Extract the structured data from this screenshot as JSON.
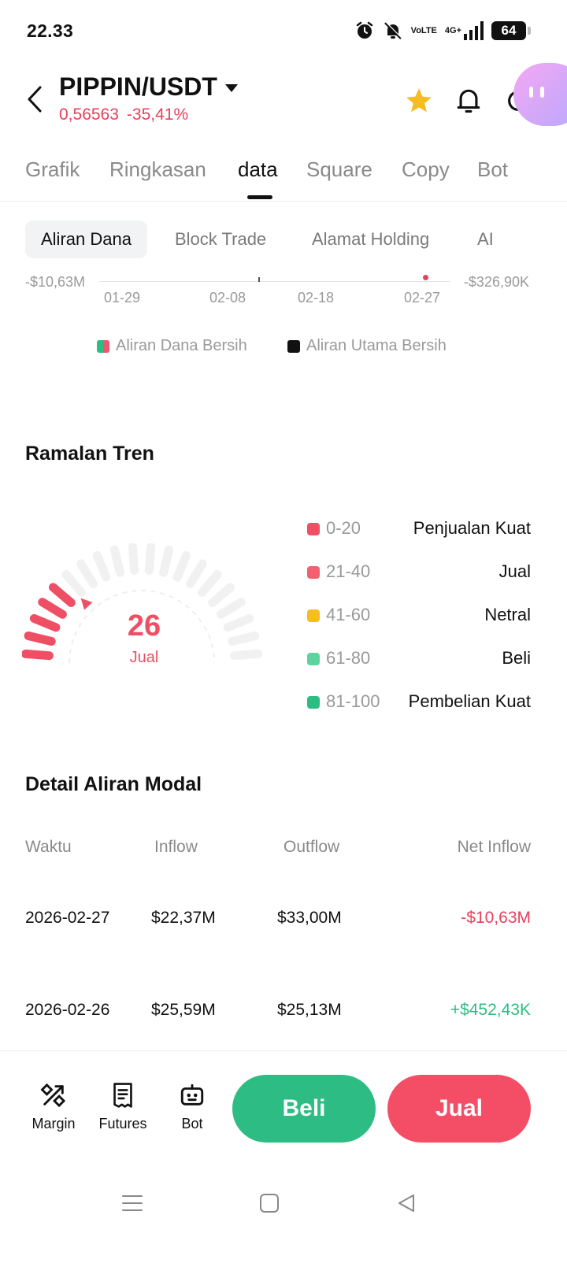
{
  "status_bar": {
    "time": "22.33",
    "network": "4G+",
    "volte_top": "Vo",
    "volte_bottom": "LTE",
    "battery": "64"
  },
  "header": {
    "pair": "PIPPIN/USDT",
    "price": "0,56563",
    "change": "-35,41%"
  },
  "main_tabs": [
    "Grafik",
    "Ringkasan",
    "data",
    "Square",
    "Copy",
    "Bot"
  ],
  "sub_tabs": [
    "Aliran Dana",
    "Block Trade",
    "Alamat Holding",
    "AI"
  ],
  "chart_data": {
    "type": "line",
    "x": [
      "01-29",
      "02-08",
      "02-18",
      "02-27"
    ],
    "left_axis_label": "-$10,63M",
    "right_axis_label": "-$326,90K",
    "series": [
      {
        "name": "Aliran Dana Bersih",
        "color": "#2dbd84"
      },
      {
        "name": "Aliran Utama Bersih",
        "color": "#111111"
      }
    ]
  },
  "trend": {
    "title": "Ramalan Tren",
    "value": "26",
    "label": "Jual",
    "value_fraction": 0.26,
    "legend": [
      {
        "range": "0-20",
        "label": "Penjualan Kuat",
        "color": "#ef4f64"
      },
      {
        "range": "21-40",
        "label": "Jual",
        "color": "#f4606f"
      },
      {
        "range": "41-60",
        "label": "Netral",
        "color": "#f5bd1f"
      },
      {
        "range": "61-80",
        "label": "Beli",
        "color": "#5dd3a0"
      },
      {
        "range": "81-100",
        "label": "Pembelian Kuat",
        "color": "#2dbd84"
      }
    ]
  },
  "capital_flow": {
    "title": "Detail Aliran Modal",
    "headers": [
      "Waktu",
      "Inflow",
      "Outflow",
      "Net Inflow"
    ],
    "rows": [
      [
        "2026-02-27",
        "$22,37M",
        "$33,00M",
        "-$10,63M"
      ],
      [
        "2026-02-26",
        "$25,59M",
        "$25,13M",
        "+$452,43K"
      ]
    ]
  },
  "bottom_bar": {
    "margin": "Margin",
    "futures": "Futures",
    "bot": "Bot",
    "buy": "Beli",
    "sell": "Jual"
  }
}
